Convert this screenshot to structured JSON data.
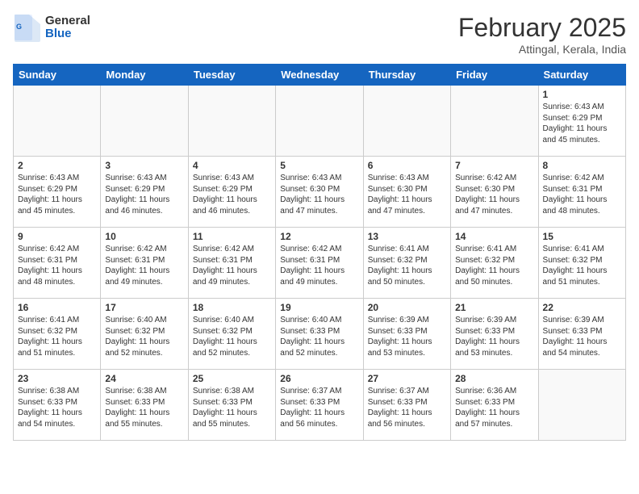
{
  "header": {
    "logo_general": "General",
    "logo_blue": "Blue",
    "title": "February 2025",
    "subtitle": "Attingal, Kerala, India"
  },
  "days_of_week": [
    "Sunday",
    "Monday",
    "Tuesday",
    "Wednesday",
    "Thursday",
    "Friday",
    "Saturday"
  ],
  "weeks": [
    [
      {
        "day": "",
        "info": ""
      },
      {
        "day": "",
        "info": ""
      },
      {
        "day": "",
        "info": ""
      },
      {
        "day": "",
        "info": ""
      },
      {
        "day": "",
        "info": ""
      },
      {
        "day": "",
        "info": ""
      },
      {
        "day": "1",
        "info": "Sunrise: 6:43 AM\nSunset: 6:29 PM\nDaylight: 11 hours and 45 minutes."
      }
    ],
    [
      {
        "day": "2",
        "info": "Sunrise: 6:43 AM\nSunset: 6:29 PM\nDaylight: 11 hours and 45 minutes."
      },
      {
        "day": "3",
        "info": "Sunrise: 6:43 AM\nSunset: 6:29 PM\nDaylight: 11 hours and 46 minutes."
      },
      {
        "day": "4",
        "info": "Sunrise: 6:43 AM\nSunset: 6:29 PM\nDaylight: 11 hours and 46 minutes."
      },
      {
        "day": "5",
        "info": "Sunrise: 6:43 AM\nSunset: 6:30 PM\nDaylight: 11 hours and 47 minutes."
      },
      {
        "day": "6",
        "info": "Sunrise: 6:43 AM\nSunset: 6:30 PM\nDaylight: 11 hours and 47 minutes."
      },
      {
        "day": "7",
        "info": "Sunrise: 6:42 AM\nSunset: 6:30 PM\nDaylight: 11 hours and 47 minutes."
      },
      {
        "day": "8",
        "info": "Sunrise: 6:42 AM\nSunset: 6:31 PM\nDaylight: 11 hours and 48 minutes."
      }
    ],
    [
      {
        "day": "9",
        "info": "Sunrise: 6:42 AM\nSunset: 6:31 PM\nDaylight: 11 hours and 48 minutes."
      },
      {
        "day": "10",
        "info": "Sunrise: 6:42 AM\nSunset: 6:31 PM\nDaylight: 11 hours and 49 minutes."
      },
      {
        "day": "11",
        "info": "Sunrise: 6:42 AM\nSunset: 6:31 PM\nDaylight: 11 hours and 49 minutes."
      },
      {
        "day": "12",
        "info": "Sunrise: 6:42 AM\nSunset: 6:31 PM\nDaylight: 11 hours and 49 minutes."
      },
      {
        "day": "13",
        "info": "Sunrise: 6:41 AM\nSunset: 6:32 PM\nDaylight: 11 hours and 50 minutes."
      },
      {
        "day": "14",
        "info": "Sunrise: 6:41 AM\nSunset: 6:32 PM\nDaylight: 11 hours and 50 minutes."
      },
      {
        "day": "15",
        "info": "Sunrise: 6:41 AM\nSunset: 6:32 PM\nDaylight: 11 hours and 51 minutes."
      }
    ],
    [
      {
        "day": "16",
        "info": "Sunrise: 6:41 AM\nSunset: 6:32 PM\nDaylight: 11 hours and 51 minutes."
      },
      {
        "day": "17",
        "info": "Sunrise: 6:40 AM\nSunset: 6:32 PM\nDaylight: 11 hours and 52 minutes."
      },
      {
        "day": "18",
        "info": "Sunrise: 6:40 AM\nSunset: 6:32 PM\nDaylight: 11 hours and 52 minutes."
      },
      {
        "day": "19",
        "info": "Sunrise: 6:40 AM\nSunset: 6:33 PM\nDaylight: 11 hours and 52 minutes."
      },
      {
        "day": "20",
        "info": "Sunrise: 6:39 AM\nSunset: 6:33 PM\nDaylight: 11 hours and 53 minutes."
      },
      {
        "day": "21",
        "info": "Sunrise: 6:39 AM\nSunset: 6:33 PM\nDaylight: 11 hours and 53 minutes."
      },
      {
        "day": "22",
        "info": "Sunrise: 6:39 AM\nSunset: 6:33 PM\nDaylight: 11 hours and 54 minutes."
      }
    ],
    [
      {
        "day": "23",
        "info": "Sunrise: 6:38 AM\nSunset: 6:33 PM\nDaylight: 11 hours and 54 minutes."
      },
      {
        "day": "24",
        "info": "Sunrise: 6:38 AM\nSunset: 6:33 PM\nDaylight: 11 hours and 55 minutes."
      },
      {
        "day": "25",
        "info": "Sunrise: 6:38 AM\nSunset: 6:33 PM\nDaylight: 11 hours and 55 minutes."
      },
      {
        "day": "26",
        "info": "Sunrise: 6:37 AM\nSunset: 6:33 PM\nDaylight: 11 hours and 56 minutes."
      },
      {
        "day": "27",
        "info": "Sunrise: 6:37 AM\nSunset: 6:33 PM\nDaylight: 11 hours and 56 minutes."
      },
      {
        "day": "28",
        "info": "Sunrise: 6:36 AM\nSunset: 6:33 PM\nDaylight: 11 hours and 57 minutes."
      },
      {
        "day": "",
        "info": ""
      }
    ]
  ]
}
